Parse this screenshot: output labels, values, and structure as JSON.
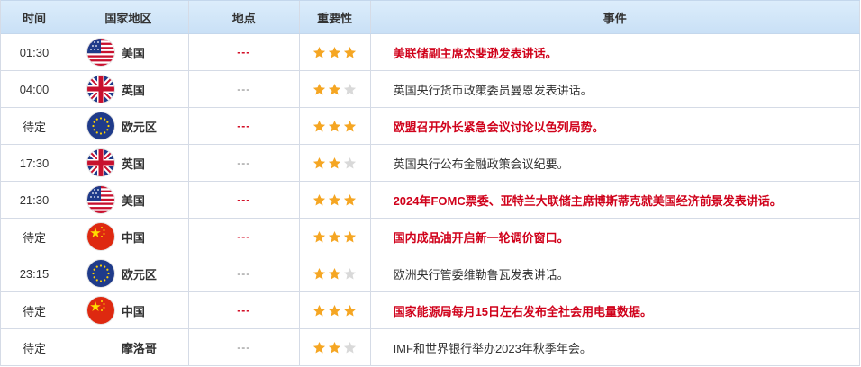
{
  "header": {
    "time": "时间",
    "country": "国家地区",
    "place": "地点",
    "importance": "重要性",
    "event": "事件"
  },
  "colors": {
    "highlight": "#d0021b",
    "star_on": "#f5a623",
    "star_off": "#d9d9d9",
    "header_bg": "#d4e7f8"
  },
  "rows": [
    {
      "time": "01:30",
      "flag": "us-flag",
      "country": "美国",
      "place": "---",
      "stars": 3,
      "event": "美联储副主席杰斐逊发表讲话。",
      "highlight": true
    },
    {
      "time": "04:00",
      "flag": "uk-flag",
      "country": "英国",
      "place": "---",
      "stars": 2,
      "event": "英国央行货币政策委员曼恩发表讲话。",
      "highlight": false
    },
    {
      "time": "待定",
      "flag": "eu-flag",
      "country": "欧元区",
      "place": "---",
      "stars": 3,
      "event": "欧盟召开外长紧急会议讨论以色列局势。",
      "highlight": true
    },
    {
      "time": "17:30",
      "flag": "uk-flag",
      "country": "英国",
      "place": "---",
      "stars": 2,
      "event": "英国央行公布金融政策会议纪要。",
      "highlight": false
    },
    {
      "time": "21:30",
      "flag": "us-flag",
      "country": "美国",
      "place": "---",
      "stars": 3,
      "event": "2024年FOMC票委、亚特兰大联储主席博斯蒂克就美国经济前景发表讲话。",
      "highlight": true
    },
    {
      "time": "待定",
      "flag": "cn-flag",
      "country": "中国",
      "place": "---",
      "stars": 3,
      "event": "国内成品油开启新一轮调价窗口。",
      "highlight": true
    },
    {
      "time": "23:15",
      "flag": "eu-flag",
      "country": "欧元区",
      "place": "---",
      "stars": 2,
      "event": "欧洲央行管委维勒鲁瓦发表讲话。",
      "highlight": false
    },
    {
      "time": "待定",
      "flag": "cn-flag",
      "country": "中国",
      "place": "---",
      "stars": 3,
      "event": "国家能源局每月15日左右发布全社会用电量数据。",
      "highlight": true
    },
    {
      "time": "待定",
      "flag": "none",
      "country": "摩洛哥",
      "place": "---",
      "stars": 2,
      "event": "IMF和世界银行举办2023年秋季年会。",
      "highlight": false
    }
  ]
}
